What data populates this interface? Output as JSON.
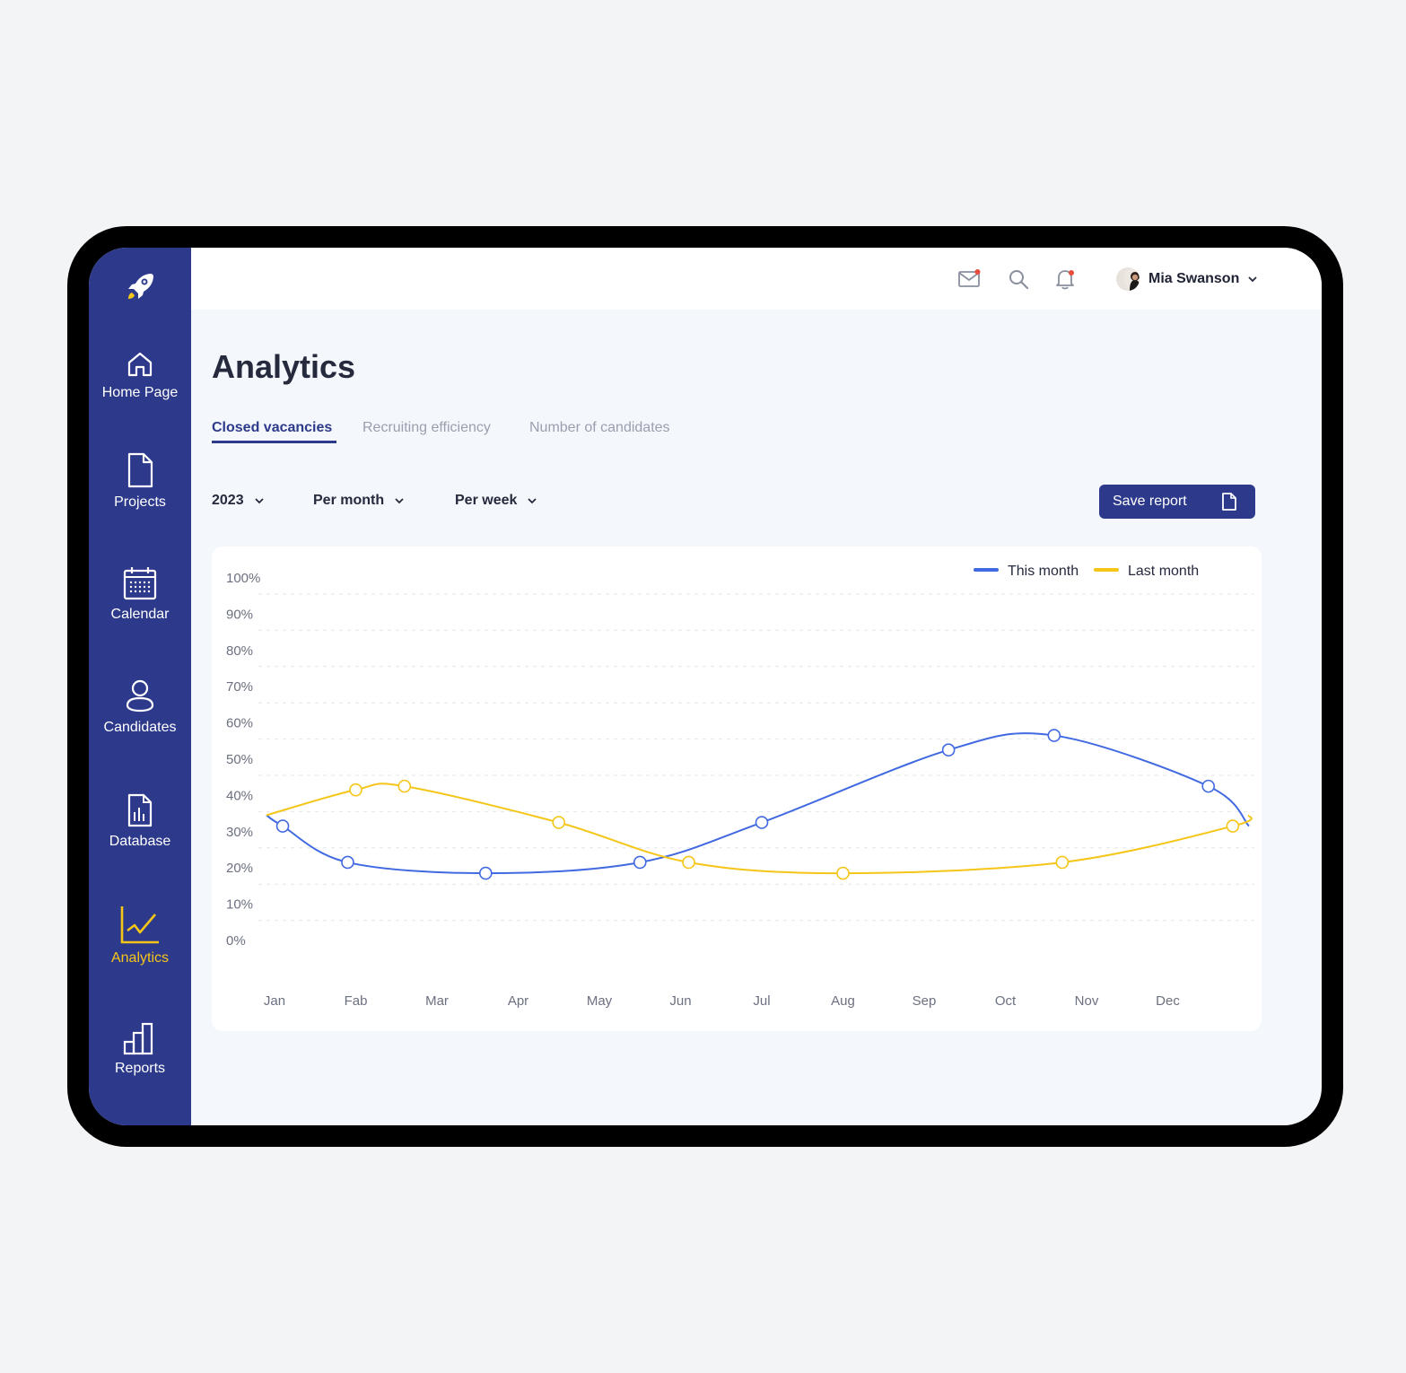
{
  "sidebar": {
    "items": [
      {
        "label": "Home Page",
        "icon": "home-icon"
      },
      {
        "label": "Projects",
        "icon": "document-icon"
      },
      {
        "label": "Calendar",
        "icon": "calendar-icon"
      },
      {
        "label": "Candidates",
        "icon": "user-icon"
      },
      {
        "label": "Database",
        "icon": "database-icon"
      },
      {
        "label": "Analytics",
        "icon": "chart-line-icon",
        "active": true
      },
      {
        "label": "Reports",
        "icon": "bar-chart-icon"
      }
    ]
  },
  "header": {
    "user_name": "Mia Swanson"
  },
  "page": {
    "title": "Analytics",
    "tabs": [
      "Closed vacancies",
      "Recruiting efficiency",
      "Number of candidates"
    ],
    "active_tab": "Closed vacancies"
  },
  "filters": {
    "year": "2023",
    "period": "Per month",
    "granularity": "Per week"
  },
  "actions": {
    "save_label": "Save report"
  },
  "colors": {
    "brand": "#2d3a8c",
    "accent": "#f5c518",
    "this_month": "#4169e1",
    "last_month": "#f5c518"
  },
  "chart_data": {
    "type": "line",
    "categories": [
      "Jan",
      "Fab",
      "Mar",
      "Apr",
      "May",
      "Jun",
      "Jul",
      "Aug",
      "Sep",
      "Oct",
      "Nov",
      "Dec"
    ],
    "y_ticks": [
      "100%",
      "90%",
      "80%",
      "70%",
      "60%",
      "50%",
      "40%",
      "30%",
      "20%",
      "10%",
      "0%"
    ],
    "ylim": [
      0,
      100
    ],
    "grid": true,
    "legend_position": "top-right",
    "series": [
      {
        "name": "This month",
        "color": "#4169e1",
        "points": [
          [
            -0.1,
            39
          ],
          [
            0.1,
            36
          ],
          [
            0.9,
            26
          ],
          [
            2.6,
            23
          ],
          [
            4.5,
            26
          ],
          [
            6.0,
            37
          ],
          [
            8.3,
            57
          ],
          [
            9.6,
            61
          ],
          [
            11.5,
            47
          ],
          [
            12.0,
            36
          ]
        ]
      },
      {
        "name": "Last month",
        "color": "#f5c518",
        "points": [
          [
            -0.1,
            39
          ],
          [
            1.0,
            46
          ],
          [
            1.6,
            47
          ],
          [
            3.5,
            37
          ],
          [
            5.1,
            26
          ],
          [
            7.0,
            23
          ],
          [
            9.7,
            26
          ],
          [
            11.8,
            36
          ],
          [
            12.0,
            39
          ]
        ]
      }
    ]
  }
}
